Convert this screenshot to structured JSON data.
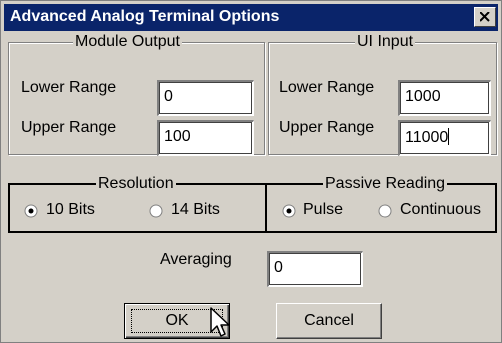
{
  "window": {
    "title": "Advanced Analog Terminal Options",
    "close_icon": "close-icon"
  },
  "module_output": {
    "legend": "Module Output",
    "lower_label": "Lower Range",
    "lower_value": "0",
    "upper_label": "Upper Range",
    "upper_value": "100"
  },
  "ui_input": {
    "legend": "UI Input",
    "lower_label": "Lower Range",
    "lower_value": "1000",
    "upper_label": "Upper Range",
    "upper_value": "11000"
  },
  "resolution": {
    "legend": "Resolution",
    "options": [
      {
        "label": "10 Bits",
        "selected": true
      },
      {
        "label": "14 Bits",
        "selected": false
      }
    ]
  },
  "passive_reading": {
    "legend": "Passive Reading",
    "options": [
      {
        "label": "Pulse",
        "selected": true
      },
      {
        "label": "Continuous",
        "selected": false
      }
    ]
  },
  "averaging": {
    "label": "Averaging",
    "value": "0"
  },
  "buttons": {
    "ok": "OK",
    "cancel": "Cancel"
  },
  "colors": {
    "titlebar": "#0a246a",
    "face": "#d4d0c8"
  }
}
